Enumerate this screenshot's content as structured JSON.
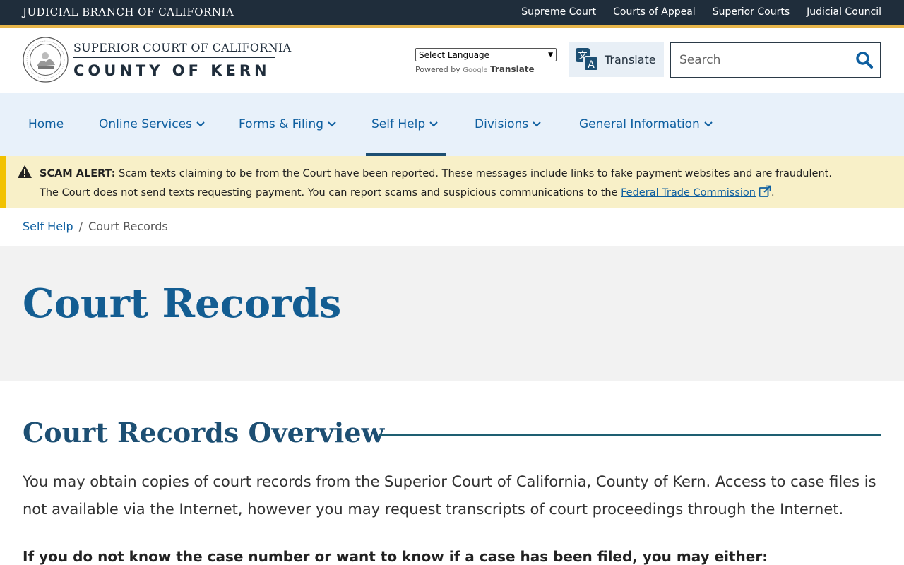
{
  "topbar": {
    "branch_title": "JUDICIAL BRANCH OF CALIFORNIA",
    "links": [
      "Supreme Court",
      "Courts of Appeal",
      "Superior Courts",
      "Judicial Council"
    ]
  },
  "header": {
    "logo_line1": "SUPERIOR COURT OF CALIFORNIA",
    "logo_line2": "COUNTY OF KERN",
    "language_select": "Select Language",
    "powered_by": "Powered by",
    "google": "Google",
    "google_translate": "Translate",
    "translate_button": "Translate",
    "search_placeholder": "Search"
  },
  "nav": {
    "items": [
      "Home",
      "Online Services",
      "Forms & Filing",
      "Self Help",
      "Divisions",
      "General Information"
    ],
    "active": "Self Help"
  },
  "alert": {
    "label": "SCAM ALERT:",
    "text": "Scam texts claiming to be from the Court have been reported. These messages include links to fake payment websites and are fraudulent. The Court does not send texts requesting payment. You can report scams and suspicious communications to the",
    "link": "Federal Trade Commission",
    "end": "."
  },
  "breadcrumb": {
    "parent": "Self Help",
    "separator": "/",
    "current": "Court Records"
  },
  "hero": {
    "title": "Court Records"
  },
  "content": {
    "section_title": "Court Records Overview",
    "paragraph": "You may obtain copies of court records from the Superior Court of California, County of Kern. Access to case files is not available via the Internet, however you may request transcripts of court proceedings through the Internet.",
    "bold_line": "If you do not know the case number or want to know if a case has been filed, you may either:"
  },
  "colors": {
    "topbar": "#1f2d3b",
    "accent": "#e6b54a",
    "link": "#0e5fa0",
    "nav_bg": "#e8f1fa",
    "alert_bg": "#f8f0c8",
    "alert_border": "#f2c200",
    "hero_bg": "#f2f2f2"
  }
}
